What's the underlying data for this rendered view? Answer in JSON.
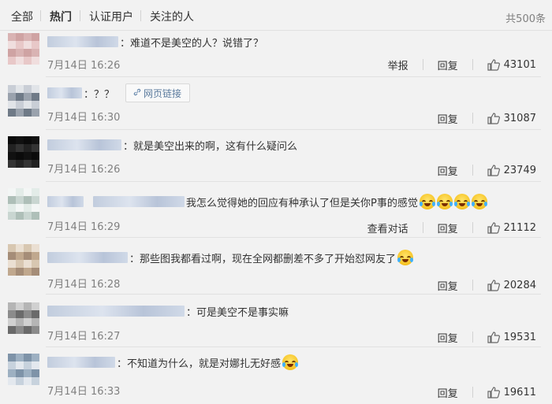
{
  "tabs": [
    {
      "label": "全部",
      "active": false
    },
    {
      "label": "热门",
      "active": true
    },
    {
      "label": "认证用户",
      "active": false
    },
    {
      "label": "关注的人",
      "active": false
    }
  ],
  "total_label": "共500条",
  "link_button_label": "网页链接",
  "comments": [
    {
      "text": "：难道不是美空的人？说错了？",
      "time": "7月14日 16:26",
      "actions": [
        "举报",
        "回复"
      ],
      "likes": "43101",
      "avatar_colors": [
        "#d9b3b3",
        "#e8c8c8",
        "#cfa3a3",
        "#f0dede"
      ]
    },
    {
      "text": "：？？",
      "time": "7月14日 16:30",
      "actions": [
        "回复"
      ],
      "likes": "31087",
      "avatar_colors": [
        "#9aa2ad",
        "#c9ced6",
        "#6f7a87",
        "#e1e4e8"
      ]
    },
    {
      "text": "：就是美空出来的啊，这有什么疑问么",
      "time": "7月14日 16:26",
      "actions": [
        "回复"
      ],
      "likes": "23749",
      "avatar_colors": [
        "#111111",
        "#222222",
        "#0b0b0b",
        "#333333"
      ]
    },
    {
      "text": "我怎么觉得她的回应有种承认了但是关你P事的感觉",
      "time": "7月14日 16:29",
      "actions": [
        "查看对话",
        "回复"
      ],
      "likes": "21112",
      "avatar_colors": [
        "#c9d6d1",
        "#e3ece8",
        "#aebfb8",
        "#f3f6f5"
      ]
    },
    {
      "text": "：那些图我都看过啊，现在全网都删差不多了开始怼网友了",
      "time": "7月14日 16:28",
      "actions": [
        "回复"
      ],
      "likes": "20284",
      "avatar_colors": [
        "#d8c7b1",
        "#c0a88e",
        "#eadfd2",
        "#a58d78"
      ]
    },
    {
      "text": "：可是美空不是事实嘛",
      "time": "7月14日 16:27",
      "actions": [
        "回复"
      ],
      "likes": "19531",
      "avatar_colors": [
        "#8b8b8b",
        "#b5b5b5",
        "#6a6a6a",
        "#d0d0d0"
      ]
    },
    {
      "text": "：不知道为什么，就是对娜扎无好感",
      "time": "7月14日 16:33",
      "actions": [
        "回复"
      ],
      "likes": "19611",
      "avatar_colors": [
        "#9db0c2",
        "#c7d2dd",
        "#7e93a8",
        "#e3e8ee"
      ]
    }
  ]
}
